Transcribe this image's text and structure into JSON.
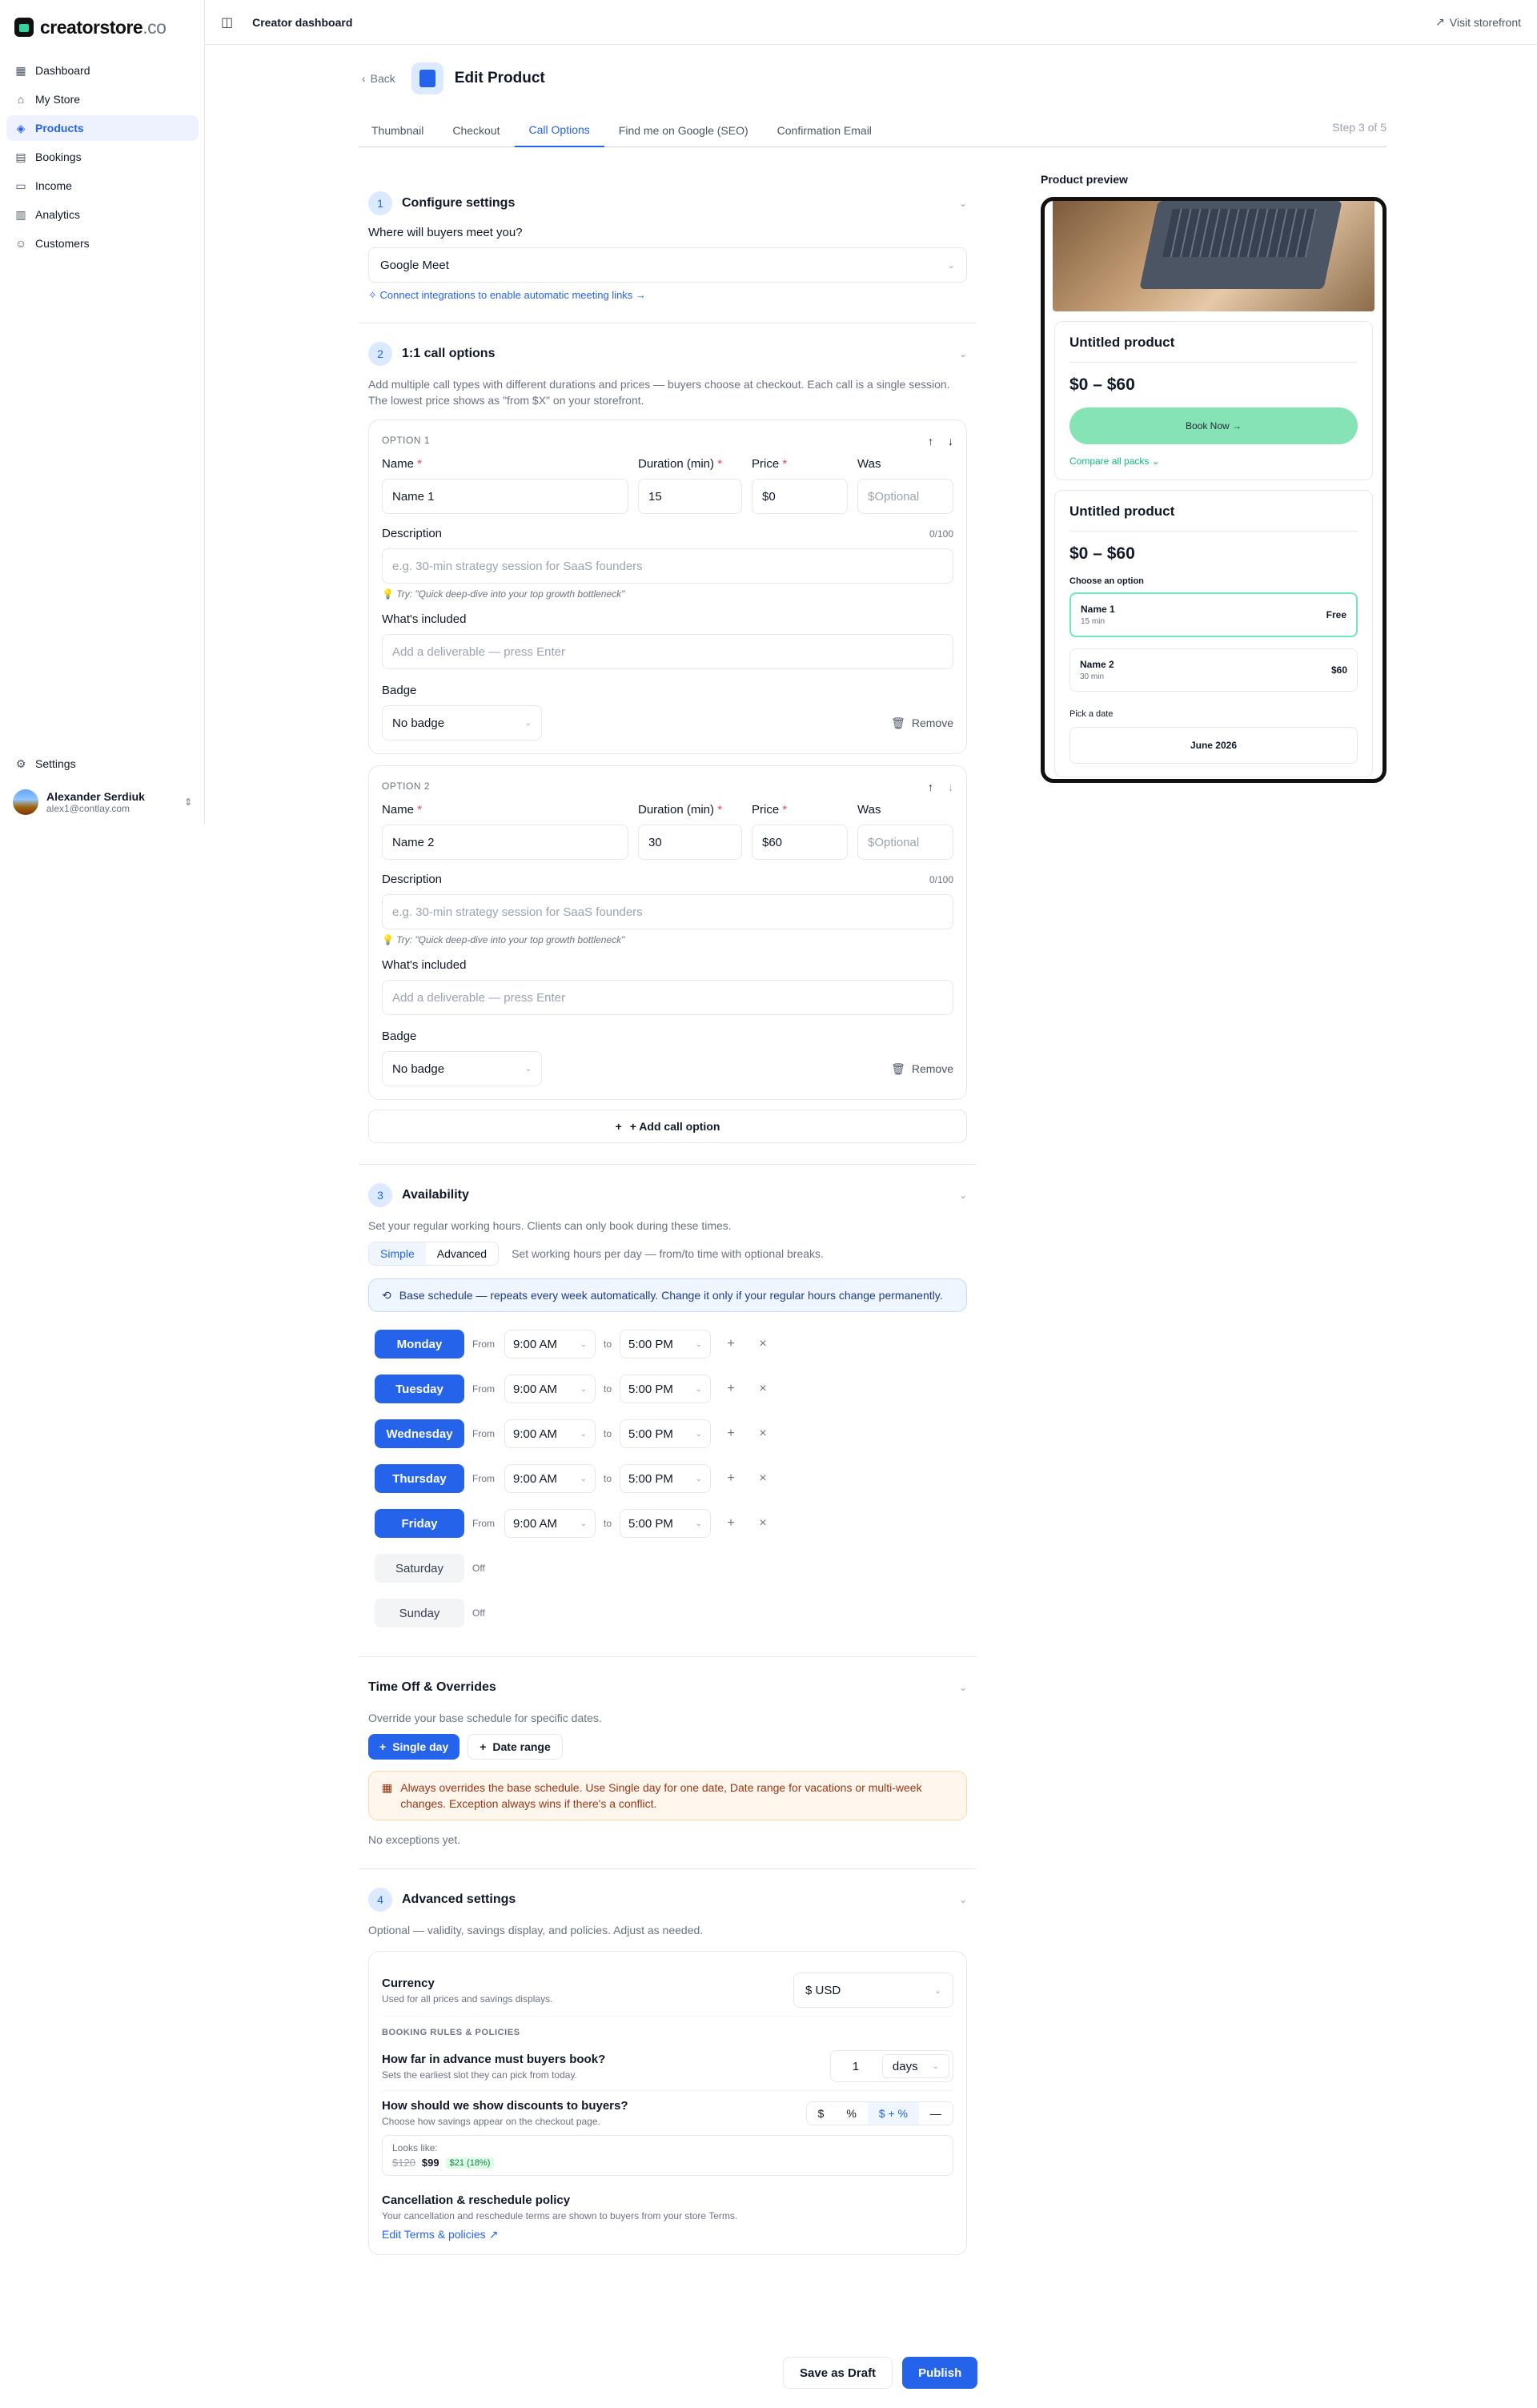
{
  "brand": {
    "name": "creatorstore",
    "suffix": ".co"
  },
  "sidebar": {
    "items": [
      {
        "label": "Dashboard",
        "icon": "grid-icon"
      },
      {
        "label": "My Store",
        "icon": "store-icon"
      },
      {
        "label": "Products",
        "icon": "box-icon",
        "active": true
      },
      {
        "label": "Bookings",
        "icon": "calendar-icon"
      },
      {
        "label": "Income",
        "icon": "wallet-icon"
      },
      {
        "label": "Analytics",
        "icon": "chart-icon"
      },
      {
        "label": "Customers",
        "icon": "users-icon"
      }
    ],
    "settings_label": "Settings",
    "user_name": "Alexander Serdiuk",
    "user_email": "alex1@contlay.com"
  },
  "topbar": {
    "title": "Creator dashboard",
    "visit": "Visit storefront"
  },
  "header": {
    "back": "Back",
    "title": "Edit Product"
  },
  "tabs": [
    {
      "label": "Thumbnail"
    },
    {
      "label": "Checkout"
    },
    {
      "label": "Call Options",
      "active": true
    },
    {
      "label": "Find me on Google (SEO)"
    },
    {
      "label": "Confirmation Email"
    }
  ],
  "step": "Step 3 of 5",
  "sec1": {
    "num": "1",
    "title": "Configure settings",
    "question": "Where will buyers meet you?",
    "meeting": "Google Meet",
    "link": "Connect integrations to enable automatic meeting links →"
  },
  "sec2": {
    "num": "2",
    "title": "1:1 call options",
    "desc": "Add multiple call types with different durations and prices — buyers choose at checkout. Each call is a single session. The lowest price shows as \"from $X\" on your storefront.",
    "labels": {
      "name": "Name",
      "duration": "Duration (min)",
      "price": "Price",
      "was": "Was",
      "req": "*",
      "description": "Description",
      "included": "What's included",
      "badge": "Badge",
      "remove": "Remove"
    },
    "options": [
      {
        "title": "OPTION 1",
        "name": "Name 1",
        "duration": "15",
        "price": "$0",
        "was_ph": "$Optional",
        "count": "0/100",
        "desc_ph": "e.g. 30-min strategy session for SaaS founders",
        "hint": "Try: \"Quick deep-dive into your top growth bottleneck\"",
        "incl_ph": "Add a deliverable — press Enter",
        "badge": "No badge"
      },
      {
        "title": "OPTION 2",
        "name": "Name 2",
        "duration": "30",
        "price": "$60",
        "was_ph": "$Optional",
        "count": "0/100",
        "desc_ph": "e.g. 30-min strategy session for SaaS founders",
        "hint": "Try: \"Quick deep-dive into your top growth bottleneck\"",
        "incl_ph": "Add a deliverable — press Enter",
        "badge": "No badge"
      }
    ],
    "add": "+ Add call option"
  },
  "sec3": {
    "num": "3",
    "title": "Availability",
    "desc": "Set your regular working hours. Clients can only book during these times.",
    "simple": "Simple",
    "advanced": "Advanced",
    "mode_desc": "Set working hours per day — from/to time with optional breaks.",
    "info": "Base schedule — repeats every week automatically. Change it only if your regular hours change permanently.",
    "from": "From",
    "to": "to",
    "off": "Off",
    "days": [
      {
        "name": "Monday",
        "start": "9:00 AM",
        "end": "5:00 PM",
        "on": true
      },
      {
        "name": "Tuesday",
        "start": "9:00 AM",
        "end": "5:00 PM",
        "on": true
      },
      {
        "name": "Wednesday",
        "start": "9:00 AM",
        "end": "5:00 PM",
        "on": true
      },
      {
        "name": "Thursday",
        "start": "9:00 AM",
        "end": "5:00 PM",
        "on": true
      },
      {
        "name": "Friday",
        "start": "9:00 AM",
        "end": "5:00 PM",
        "on": true
      },
      {
        "name": "Saturday",
        "on": false
      },
      {
        "name": "Sunday",
        "on": false
      }
    ]
  },
  "timeoff": {
    "title": "Time Off & Overrides",
    "desc": "Override your base schedule for specific dates.",
    "single": "Single day",
    "range": "Date range",
    "warn": "Always overrides the base schedule. Use Single day for one date, Date range for vacations or multi-week changes. Exception always wins if there's a conflict.",
    "empty": "No exceptions yet."
  },
  "sec4": {
    "num": "4",
    "title": "Advanced settings",
    "desc": "Optional — validity, savings display, and policies. Adjust as needed.",
    "currency_t": "Currency",
    "currency_s": "Used for all prices and savings displays.",
    "currency": "$ USD",
    "caps": "BOOKING RULES & POLICIES",
    "adv_t": "How far in advance must buyers book?",
    "adv_s": "Sets the earliest slot they can pick from today.",
    "adv_n": "1",
    "adv_unit": "days",
    "disc_t": "How should we show discounts to buyers?",
    "disc_s": "Choose how savings appear on the checkout page.",
    "disc_opts": [
      "$",
      "%",
      "$ + %",
      "—"
    ],
    "looks": "Looks like:",
    "old": "$120",
    "new": "$99",
    "save": "$21 (18%)",
    "pol_t": "Cancellation & reschedule policy",
    "pol_s": "Your cancellation and reschedule terms are shown to buyers from your store Terms.",
    "pol_link": "Edit Terms & policies"
  },
  "preview": {
    "label": "Product preview",
    "title": "Untitled product",
    "price": "$0 – $60",
    "book": "Book Now",
    "compare": "Compare all packs",
    "title2": "Untitled product",
    "price2": "$0 – $60",
    "choose": "Choose an option",
    "opts": [
      {
        "name": "Name 1",
        "dur": "15 min",
        "val": "Free"
      },
      {
        "name": "Name 2",
        "dur": "30 min",
        "val": "$60"
      }
    ],
    "pick": "Pick a date",
    "month": "June 2026"
  },
  "footer": {
    "draft": "Save as Draft",
    "publish": "Publish"
  }
}
